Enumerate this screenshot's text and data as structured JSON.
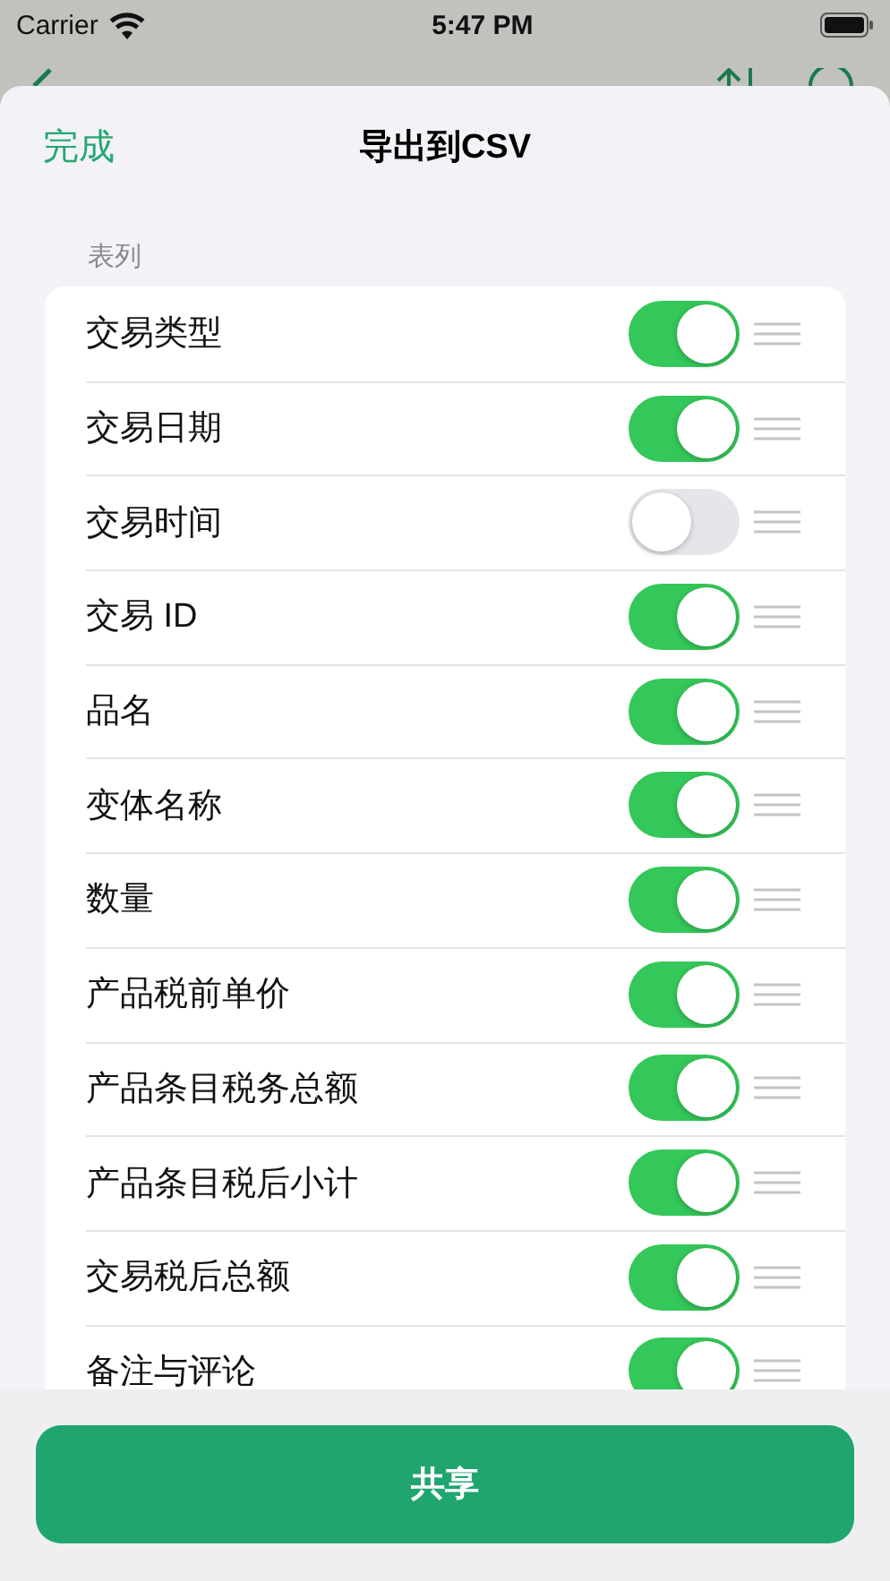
{
  "status_bar": {
    "carrier": "Carrier",
    "time": "5:47 PM"
  },
  "sheet": {
    "done_button": "完成",
    "title": "导出到CSV"
  },
  "section_header": "表列",
  "columns": [
    {
      "label": "交易类型",
      "on": true
    },
    {
      "label": "交易日期",
      "on": true
    },
    {
      "label": "交易时间",
      "on": false
    },
    {
      "label": "交易 ID",
      "on": true
    },
    {
      "label": "品名",
      "on": true
    },
    {
      "label": "变体名称",
      "on": true
    },
    {
      "label": "数量",
      "on": true
    },
    {
      "label": "产品税前单价",
      "on": true
    },
    {
      "label": "产品条目税务总额",
      "on": true
    },
    {
      "label": "产品条目税后小计",
      "on": true
    },
    {
      "label": "交易税后总额",
      "on": true
    },
    {
      "label": "备注与评论",
      "on": true
    }
  ],
  "share_button": "共享"
}
